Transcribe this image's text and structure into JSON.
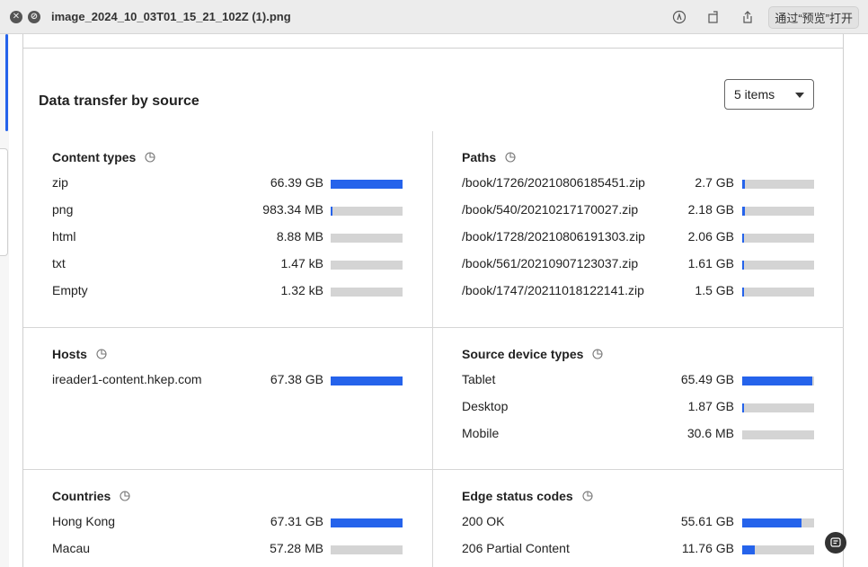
{
  "window": {
    "title": "image_2024_10_03T01_15_21_102Z (1).png",
    "open_with_label": "通过“预览”打开"
  },
  "icons": {
    "close": "close-icon",
    "block": "no-entry-icon",
    "markup": "markup-pen-icon",
    "rotate": "rotate-icon",
    "share": "share-icon",
    "help": "feedback-icon"
  },
  "panel": {
    "title": "Data transfer by source",
    "select": {
      "value": "5 items"
    },
    "accent_color": "#2563eb"
  },
  "content_types": {
    "title": "Content types",
    "rows": [
      {
        "label": "zip",
        "value": "66.39 GB",
        "fraction": 1.0
      },
      {
        "label": "png",
        "value": "983.34 MB",
        "fraction": 0.015
      },
      {
        "label": "html",
        "value": "8.88 MB",
        "fraction": 0.0
      },
      {
        "label": "txt",
        "value": "1.47 kB",
        "fraction": 0.0
      },
      {
        "label": "Empty",
        "value": "1.32 kB",
        "fraction": 0.0
      }
    ]
  },
  "paths": {
    "title": "Paths",
    "rows": [
      {
        "label": "/book/1726/20210806185451.zip",
        "value": "2.7 GB",
        "fraction": 0.04
      },
      {
        "label": "/book/540/20210217170027.zip",
        "value": "2.18 GB",
        "fraction": 0.033
      },
      {
        "label": "/book/1728/20210806191303.zip",
        "value": "2.06 GB",
        "fraction": 0.031
      },
      {
        "label": "/book/561/20210907123037.zip",
        "value": "1.61 GB",
        "fraction": 0.024
      },
      {
        "label": "/book/1747/20211018122141.zip",
        "value": "1.5 GB",
        "fraction": 0.022
      }
    ]
  },
  "hosts": {
    "title": "Hosts",
    "rows": [
      {
        "label": "ireader1-content.hkep.com",
        "value": "67.38 GB",
        "fraction": 1.0
      }
    ]
  },
  "source_device_types": {
    "title": "Source device types",
    "rows": [
      {
        "label": "Tablet",
        "value": "65.49 GB",
        "fraction": 0.972
      },
      {
        "label": "Desktop",
        "value": "1.87 GB",
        "fraction": 0.028
      },
      {
        "label": "Mobile",
        "value": "30.6 MB",
        "fraction": 0.0
      }
    ]
  },
  "countries": {
    "title": "Countries",
    "rows": [
      {
        "label": "Hong Kong",
        "value": "67.31 GB",
        "fraction": 1.0
      },
      {
        "label": "Macau",
        "value": "57.28 MB",
        "fraction": 0.0
      }
    ]
  },
  "edge_status_codes": {
    "title": "Edge status codes",
    "rows": [
      {
        "label": "200 OK",
        "value": "55.61 GB",
        "fraction": 0.825
      },
      {
        "label": "206 Partial Content",
        "value": "11.76 GB",
        "fraction": 0.175
      }
    ]
  }
}
